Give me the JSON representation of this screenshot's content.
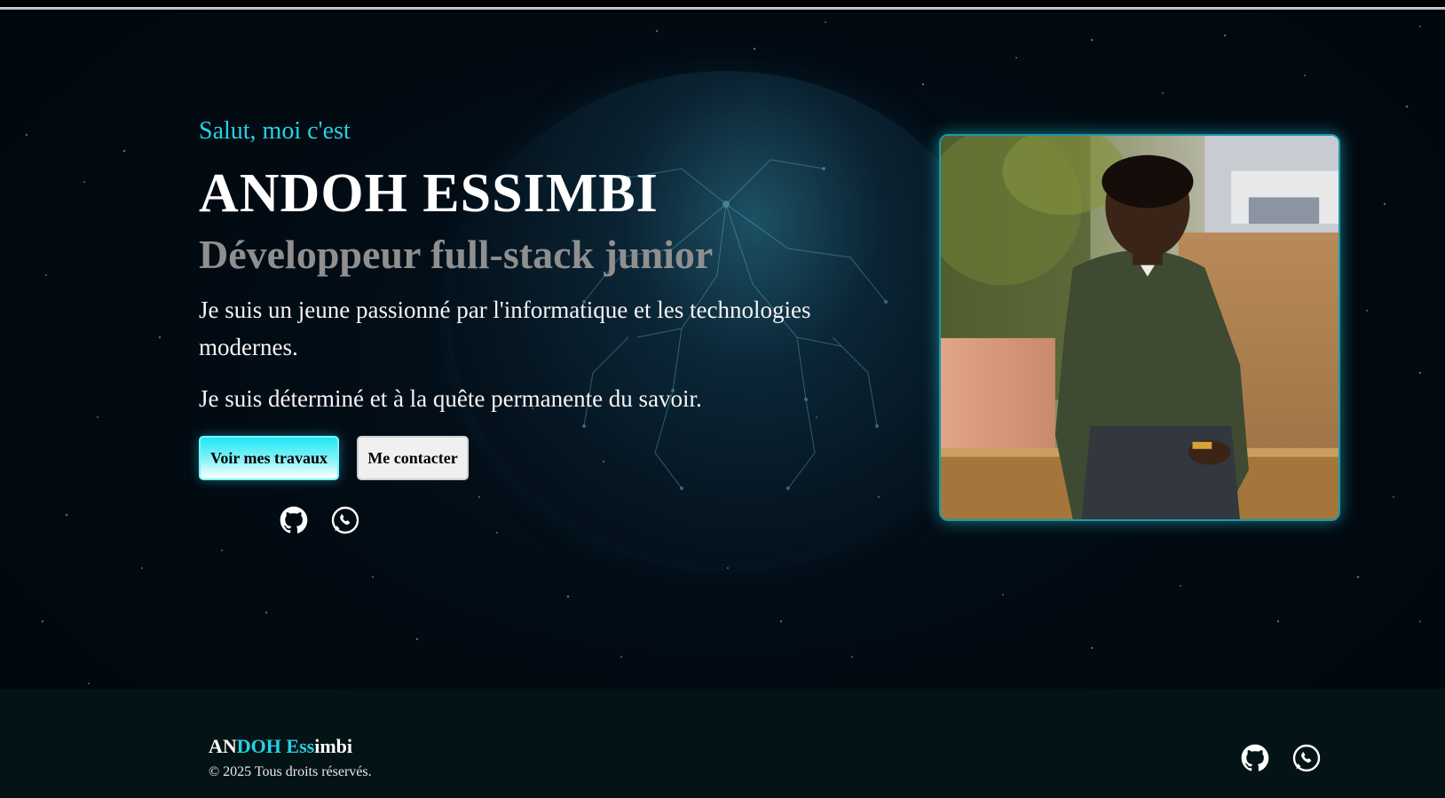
{
  "hero": {
    "greeting": "Salut, moi c'est",
    "name": "ANDOH ESSIMBI",
    "role": "Développeur full-stack junior",
    "description_1": "Je suis un jeune passionné par l'informatique et les technologies modernes.",
    "description_2": "Je suis déterminé et à la quête permanente du savoir.",
    "buttons": {
      "primary": "Voir mes travaux",
      "secondary": "Me contacter"
    },
    "social_icons": [
      "github-icon",
      "whatsapp-icon"
    ]
  },
  "profile_photo": {
    "subject": "portrait-photo"
  },
  "footer": {
    "brand_part1": "AN",
    "brand_part2": "DOH Ess",
    "brand_part3": "imbi",
    "copyright": "© 2025 Tous droits réservés.",
    "social_icons": [
      "github-icon",
      "whatsapp-icon"
    ]
  },
  "colors": {
    "accent": "#22d3e6",
    "background": "#020a12",
    "footer_background": "#041416",
    "role_text": "#8f8f8f"
  }
}
